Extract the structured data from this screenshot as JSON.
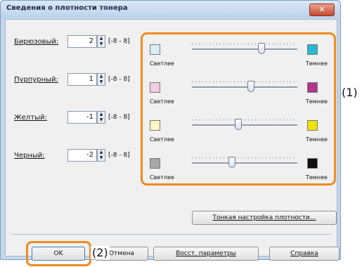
{
  "window": {
    "title": "Сведения о плотности тонера",
    "close_symbol": "✕"
  },
  "rows": [
    {
      "label": "Бирюзовый:",
      "value": "2",
      "range": "[-8 - 8]",
      "light_label": "Светлее",
      "dark_label": "Темнее",
      "light_color": "#d8eef6",
      "dark_color": "#29b7d3",
      "level_percent": 66
    },
    {
      "label": "Пурпурный:",
      "value": "1",
      "range": "[-8 - 8]",
      "light_label": "Светлее",
      "dark_label": "Темнее",
      "light_color": "#f3cde4",
      "dark_color": "#b0358c",
      "level_percent": 56
    },
    {
      "label": "Желтый:",
      "value": "-1",
      "range": "[-8 - 8]",
      "light_label": "Светлее",
      "dark_label": "Темнее",
      "light_color": "#fff6c6",
      "dark_color": "#efe200",
      "level_percent": 44
    },
    {
      "label": "Черный:",
      "value": "-2",
      "range": "[-8 - 8]",
      "light_label": "Светлее",
      "dark_label": "Темнее",
      "light_color": "#a7a7a7",
      "dark_color": "#111111",
      "level_percent": 38
    }
  ],
  "buttons": {
    "fine_tune": "Тонкая настройка плотности...",
    "ok": "OK",
    "cancel": "Отмена",
    "restore": "Восст. параметры",
    "help": "Справка"
  },
  "callouts": {
    "one": "(1)",
    "two": "(2)"
  },
  "colors": {
    "highlight": "#f08a20"
  }
}
